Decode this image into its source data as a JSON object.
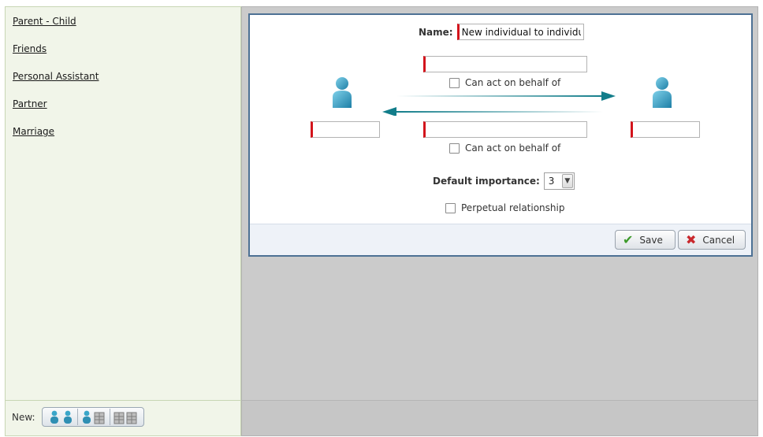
{
  "sidebar": {
    "relationship_types": [
      {
        "label": "Parent - Child"
      },
      {
        "label": "Friends"
      },
      {
        "label": "Personal Assistant"
      },
      {
        "label": "Partner"
      },
      {
        "label": "Marriage"
      }
    ],
    "new_label": "New:",
    "new_buttons": [
      {
        "icon": "individual-to-individual-icon"
      },
      {
        "icon": "individual-to-organization-icon"
      },
      {
        "icon": "organization-to-organization-icon"
      }
    ]
  },
  "dialog": {
    "name_label": "Name:",
    "name_value": "New individual to individual",
    "forward_checkbox_label": "Can act on behalf of",
    "reverse_checkbox_label": "Can act on behalf of",
    "forward_role_value": "",
    "reverse_role_value": "",
    "left_person_value": "",
    "right_person_value": "",
    "default_importance_label": "Default importance:",
    "default_importance_value": "3",
    "perpetual_label": "Perpetual relationship",
    "save_label": "Save",
    "cancel_label": "Cancel"
  },
  "colors": {
    "required_marker": "#d3141c",
    "arrow": "#127d8a",
    "person_icon": "#3aa6c9",
    "dialog_border": "#4d7194"
  }
}
